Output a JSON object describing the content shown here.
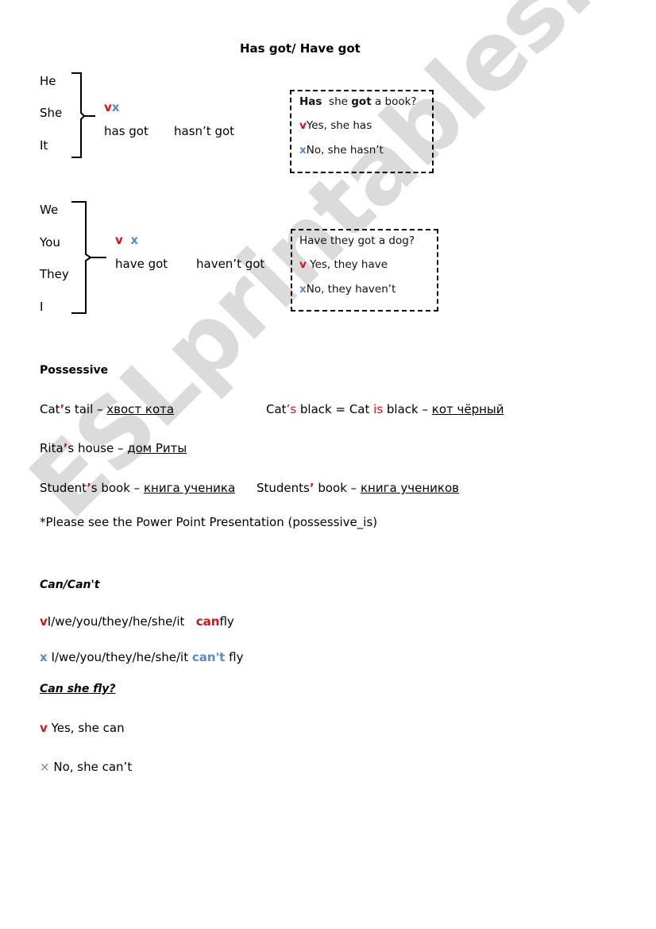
{
  "title": "Has got/ Have got",
  "section1": {
    "pronouns": [
      "He",
      "She",
      "It"
    ],
    "check_mark": "v",
    "cross_mark": "x",
    "positive": "has got",
    "negative": "hasn’t got",
    "box": {
      "question_part1": "Has",
      "question_part2": "she",
      "question_part3": "got",
      "question_part4": "a book?",
      "yes": "Yes, she has",
      "no": "No, she hasn’t"
    }
  },
  "section2": {
    "pronouns": [
      "We",
      "You",
      "They",
      "I"
    ],
    "check_mark": "v",
    "cross_mark": "x",
    "positive": "have got",
    "negative": "haven’t got",
    "box": {
      "question": "Have they got a dog?",
      "yes": "Yes, they have",
      "no": "No, they haven’t"
    }
  },
  "possessive": {
    "heading": "Possessive",
    "lines": [
      {
        "pre": "Cat",
        "apos": "’",
        "post": "s tail – ",
        "translation": "хвост кота"
      },
      {
        "pre": "Rita",
        "apos": "’",
        "post": "s house – ",
        "translation": "дом Риты"
      },
      {
        "pre": "Student",
        "apos": "’",
        "post": "s book – ",
        "translation": "книга ученика "
      }
    ],
    "cat_is": {
      "pre": "Cat",
      "apos_s": "’s",
      "mid": " black = Cat ",
      "is": "is",
      "post": " black – ",
      "translation": "кот чёрный"
    },
    "students_plural": {
      "pre": "Students",
      "apos": "’",
      "post": " book – ",
      "translation": "книга учеников"
    },
    "note": "*Please see the Power Point Presentation (possessive_is)"
  },
  "can": {
    "heading": "Can/Can't",
    "positive": {
      "mark": "v",
      "subject": "I/we/you/they/he/she/it",
      "modal": "can",
      "verb": "fly"
    },
    "negative": {
      "mark": "x",
      "subject": "I/we/you/they/he/she/it",
      "modal": "can't",
      "verb": "fly"
    },
    "question": "Can she fly?",
    "yes": {
      "mark": "v",
      "text": "Yes, she can"
    },
    "no": {
      "mark": "×",
      "text": "No, she can’t"
    }
  },
  "watermark": "ESLprintables.com",
  "colors": {
    "check": "#d0141c",
    "cross": "#5b8ac4"
  }
}
